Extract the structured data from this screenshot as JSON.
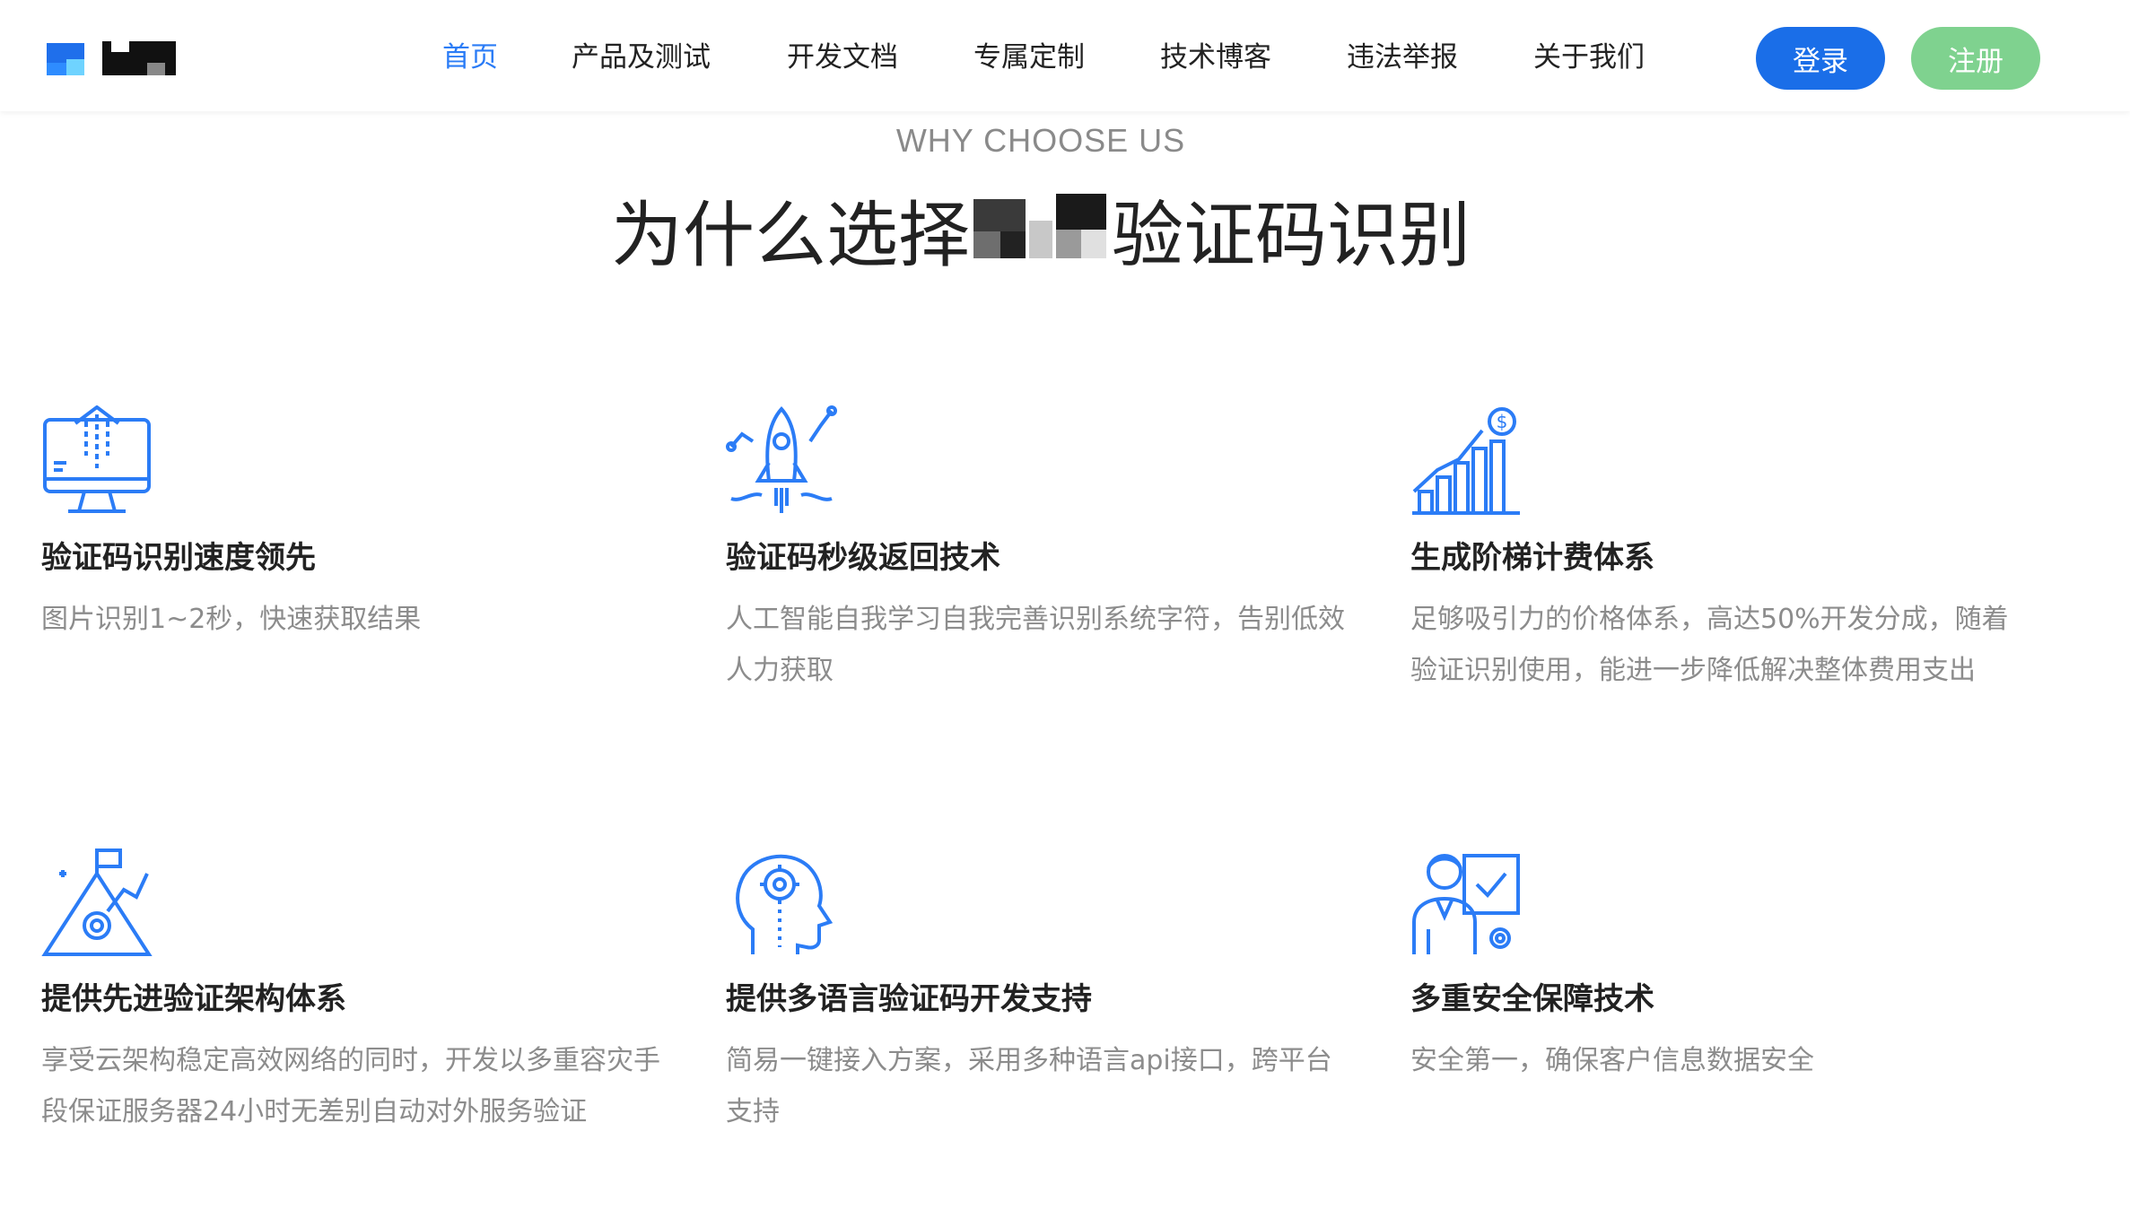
{
  "header": {
    "nav": [
      {
        "label": "首页",
        "active": true
      },
      {
        "label": "产品及测试",
        "active": false
      },
      {
        "label": "开发文档",
        "active": false
      },
      {
        "label": "专属定制",
        "active": false
      },
      {
        "label": "技术博客",
        "active": false
      },
      {
        "label": "违法举报",
        "active": false
      },
      {
        "label": "关于我们",
        "active": false
      }
    ],
    "login_label": "登录",
    "register_label": "注册"
  },
  "section": {
    "subtitle": "WHY CHOOSE US",
    "title_prefix": "为什么选择",
    "title_suffix": "验证码识别"
  },
  "features": [
    {
      "icon": "monitor-upload-icon",
      "title": "验证码识别速度领先",
      "desc": "图片识别1~2秒，快速获取结果"
    },
    {
      "icon": "rocket-icon",
      "title": "验证码秒级返回技术",
      "desc": "人工智能自我学习自我完善识别系统字符，告别低效人力获取"
    },
    {
      "icon": "growth-bar-chart-icon",
      "title": "生成阶梯计费体系",
      "desc": "足够吸引力的价格体系，高达50%开发分成，随着验证识别使用，能进一步降低解决整体费用支出"
    },
    {
      "icon": "mountain-gear-flag-icon",
      "title": "提供先进验证架构体系",
      "desc": "享受云架构稳定高效网络的同时，开发以多重容灾手段保证服务器24小时无差别自动对外服务验证"
    },
    {
      "icon": "head-gear-icon",
      "title": "提供多语言验证码开发支持",
      "desc": "简易一键接入方案，采用多种语言api接口，跨平台支持"
    },
    {
      "icon": "person-checkboard-icon",
      "title": "多重安全保障技术",
      "desc": "安全第一，确保客户信息数据安全"
    }
  ],
  "colors": {
    "accent": "#2b7cf6",
    "login": "#1a6ee8",
    "register": "#7fd28f",
    "icon": "#2b7cf6"
  }
}
